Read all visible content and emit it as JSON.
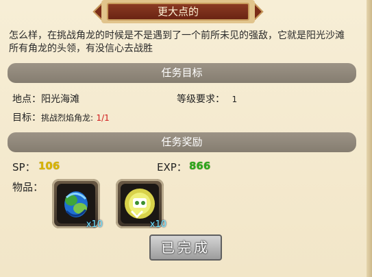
{
  "title": "更大点的",
  "description_lines": [
    "怎么样，在挑战角龙的时候是不是遇到了一个前所未见的强敌，它就是阳光沙滩",
    "所有角龙的头领，有没信心去战胜"
  ],
  "target_section": {
    "header": "任务目标",
    "location_label": "地点：阳光海滩",
    "level_label": "等级要求：",
    "level_value": "1",
    "goal_label": "目标：",
    "goal_text": "挑战烈焰角龙:",
    "goal_progress": "1/1"
  },
  "reward_section": {
    "header": "任务奖励",
    "sp_label": "SP：",
    "sp_value": "106",
    "exp_label": "EXP：",
    "exp_value": "866",
    "items_label": "物品：",
    "items": [
      {
        "icon": "blue-green-orb-icon",
        "qty": "x10"
      },
      {
        "icon": "golden-robot-orb-icon",
        "qty": "x10"
      }
    ]
  },
  "button_label": "已完成",
  "colors": {
    "accent_yellow": "#d9b400",
    "accent_green": "#2fa71c",
    "progress_red": "#d0181a"
  }
}
